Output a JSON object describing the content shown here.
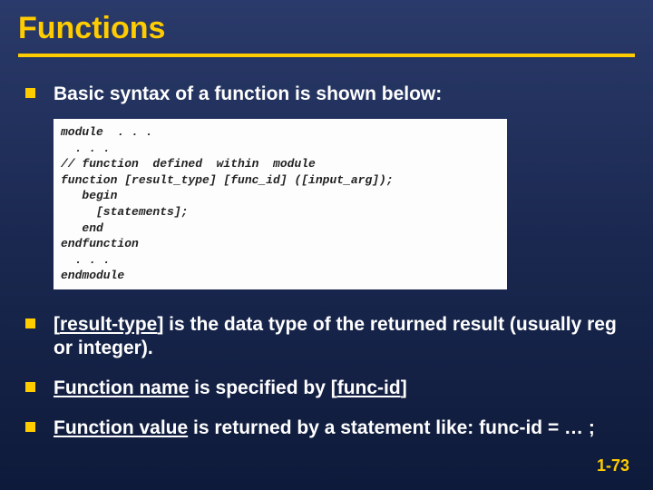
{
  "title": "Functions",
  "bullets": [
    {
      "html": "Basic syntax of a function is shown below:"
    },
    {
      "html": "[<span class='u'>result-type</span>] is the data type of the returned result (usually reg or integer)."
    },
    {
      "html": "<span class='u'>Function name</span> is specified by [<span class='u'>func-id</span>]"
    },
    {
      "html": "<span class='u'>Function value</span> is returned by a statement like: func-id = … ;"
    }
  ],
  "code": "module  . . .\n  . . .\n// function  defined  within  module\nfunction [result_type] [func_id] ([input_arg]);\n   begin\n     [statements];\n   end\nendfunction\n  . . .\nendmodule",
  "slide_number": "1-73"
}
